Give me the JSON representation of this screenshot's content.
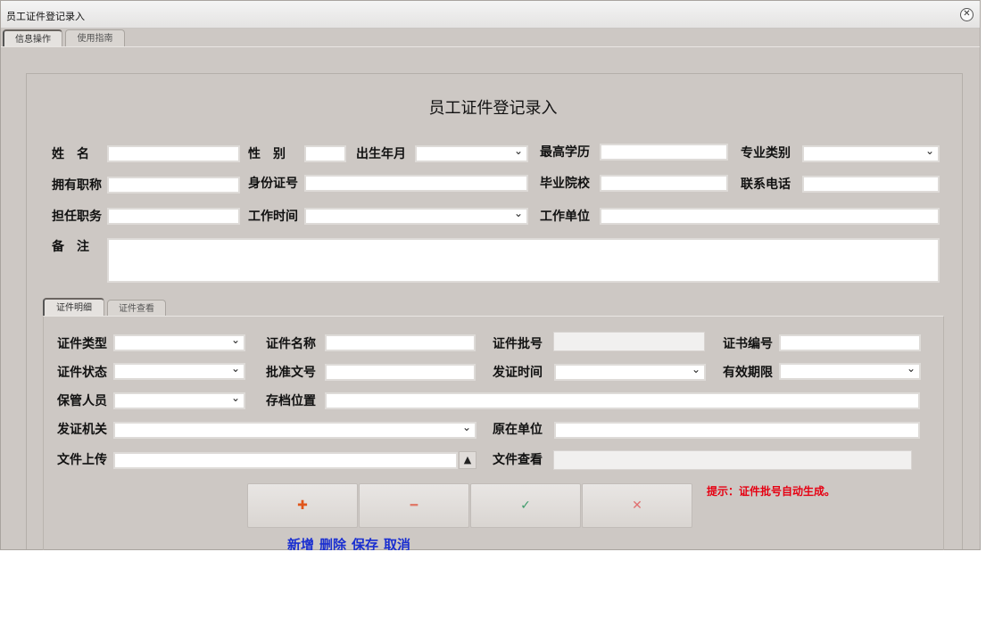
{
  "window": {
    "title": "员工证件登记录入",
    "close_icon": "close-icon"
  },
  "tabs": [
    "信息操作",
    "使用指南"
  ],
  "heading": "员工证件登记录入",
  "form": {
    "name_label": "姓　名",
    "gender_label": "性　别",
    "birth_label": "出生年月",
    "education_label": "最高学历",
    "major_label": "专业类别",
    "title_label": "拥有职称",
    "idcard_label": "身份证号",
    "school_label": "毕业院校",
    "phone_label": "联系电话",
    "position_label": "担任职务",
    "worktime_label": "工作时间",
    "workunit_label": "工作单位",
    "remark_label": "备　注"
  },
  "subtabs": [
    "证件明细",
    "证件查看"
  ],
  "cert": {
    "type_label": "证件类型",
    "name_label": "证件名称",
    "batch_label": "证件批号",
    "number_label": "证书编号",
    "status_label": "证件状态",
    "approval_label": "批准文号",
    "issue_time_label": "发证时间",
    "validity_label": "有效期限",
    "keeper_label": "保管人员",
    "archive_label": "存档位置",
    "authority_label": "发证机关",
    "orig_unit_label": "原在单位",
    "upload_label": "文件上传",
    "view_label": "文件查看"
  },
  "actions": {
    "add_icon": "✚",
    "delete_icon": "━",
    "save_icon": "✓",
    "cancel_icon": "✕",
    "add_label": "新增",
    "delete_label": "删除",
    "save_label": "保存",
    "cancel_label": "取消"
  },
  "hint": "提示：证件批号自动生成。",
  "colors": {
    "hint": "#e60012",
    "labels": "#1a2fd0",
    "add": "#e0561b",
    "delete": "#e07b6a",
    "save": "#3f9c6c",
    "cancel": "#e07070"
  }
}
